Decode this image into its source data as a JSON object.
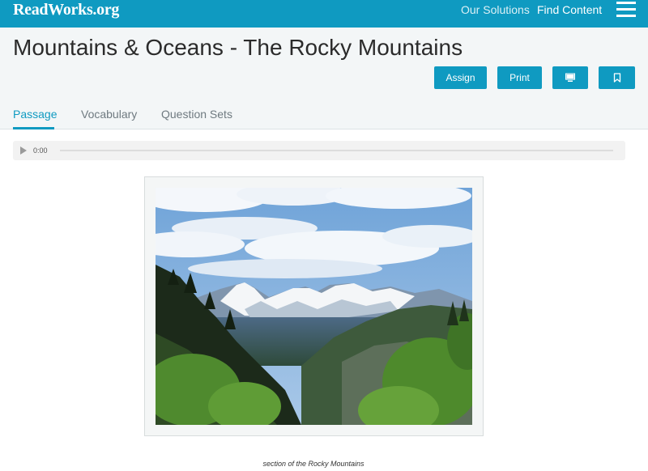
{
  "header": {
    "logo": "ReadWorks.org",
    "nav": {
      "solutions": "Our Solutions",
      "find_content": "Find Content"
    }
  },
  "passage": {
    "title": "Mountains & Oceans - The Rocky Mountains",
    "actions": {
      "assign": "Assign",
      "print": "Print"
    },
    "tabs": [
      {
        "label": "Passage",
        "active": true
      },
      {
        "label": "Vocabulary",
        "active": false
      },
      {
        "label": "Question Sets",
        "active": false
      }
    ]
  },
  "audio": {
    "current_time": "0:00",
    "progress": 0
  },
  "figure": {
    "caption": "section of the Rocky Mountains"
  },
  "colors": {
    "brand": "#0f9ac1",
    "header_bg": "#f3f6f7"
  }
}
